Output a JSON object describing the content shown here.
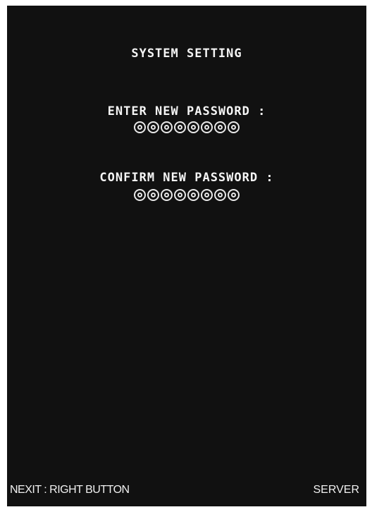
{
  "screen": {
    "title": "SYSTEM SETTING"
  },
  "password": {
    "enter_label": "ENTER NEW PASSWORD :",
    "enter_digit_count": 8,
    "confirm_label": "CONFIRM NEW PASSWORD :",
    "confirm_digit_count": 8,
    "digit_icon": "double-circle-icon"
  },
  "footer": {
    "next_hint": "NEXIT : RIGHT BUTTON",
    "mode": "SERVER"
  }
}
